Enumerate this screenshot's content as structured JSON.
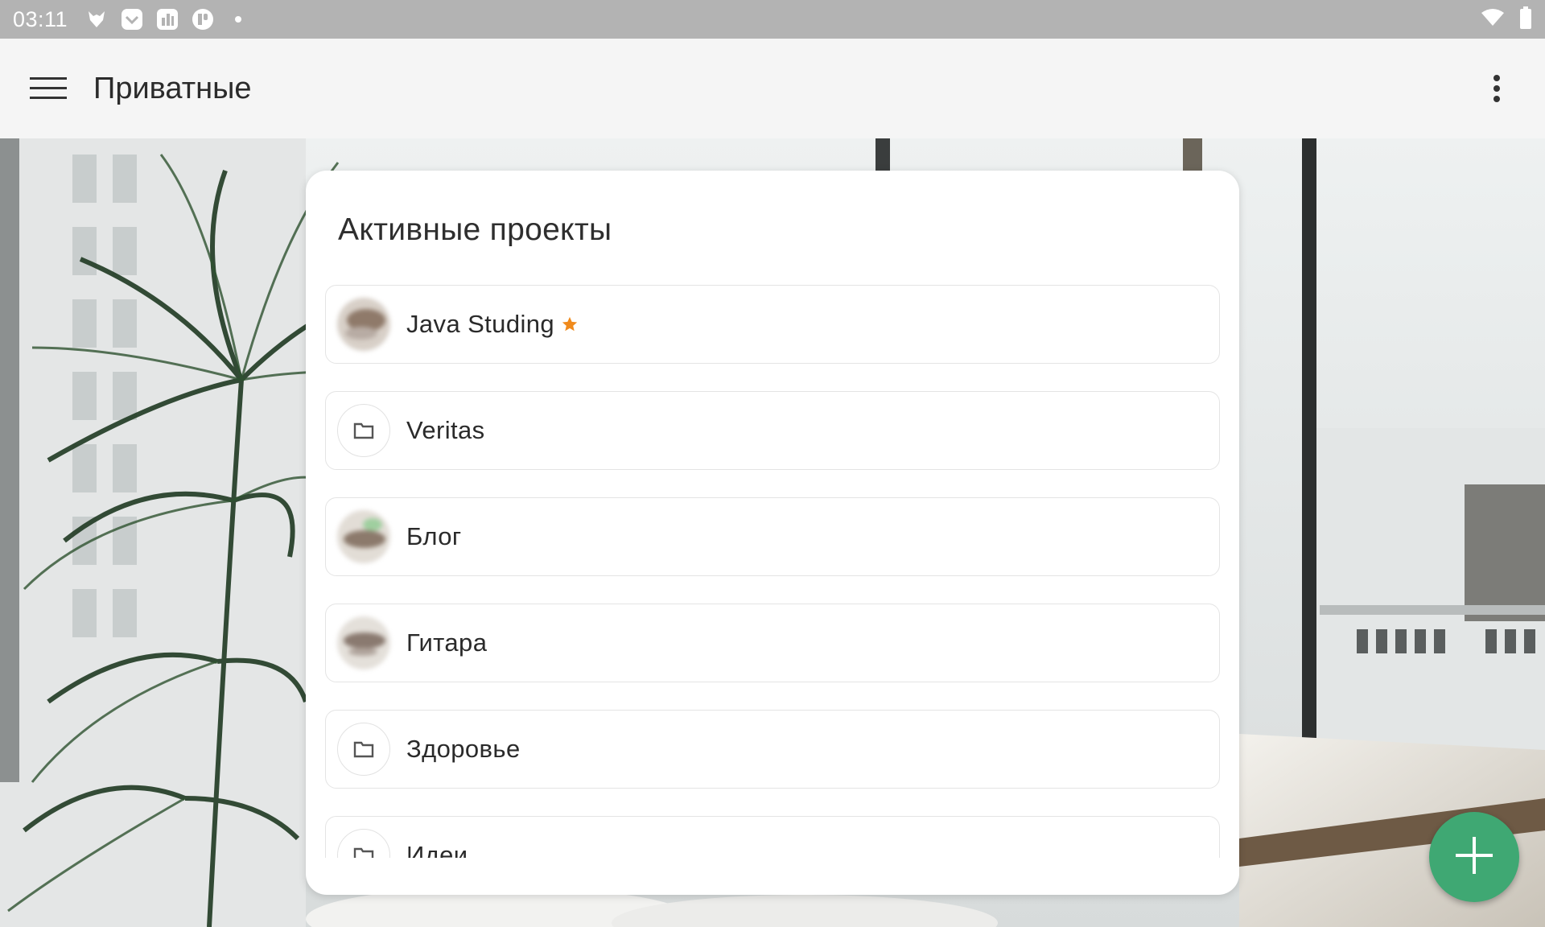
{
  "status_bar": {
    "time": "03:11",
    "notification_icons": [
      "fox-icon",
      "check-box-icon",
      "chart-box-icon",
      "app-circle-icon",
      "dot-icon"
    ],
    "right_icons": [
      "wifi-icon",
      "battery-icon"
    ]
  },
  "app_bar": {
    "menu_icon": "hamburger-menu-icon",
    "title": "Приватные",
    "more_icon": "more-vert-icon"
  },
  "card": {
    "title": "Активные проекты",
    "projects": [
      {
        "label": "Java Studing",
        "avatar": "photo",
        "favorite": true
      },
      {
        "label": "Veritas",
        "avatar": "folder-icon",
        "favorite": false
      },
      {
        "label": "Блог",
        "avatar": "photo",
        "favorite": false
      },
      {
        "label": "Гитара",
        "avatar": "photo",
        "favorite": false
      },
      {
        "label": "Здоровье",
        "avatar": "folder-icon",
        "favorite": false
      },
      {
        "label": "Идеи",
        "avatar": "folder-icon",
        "favorite": false
      }
    ]
  },
  "fab": {
    "icon": "plus-icon"
  },
  "colors": {
    "status_bar": "#b3b3b3",
    "app_bar": "#f5f5f5",
    "fab": "#3fa873",
    "star": "#f08a1c"
  }
}
